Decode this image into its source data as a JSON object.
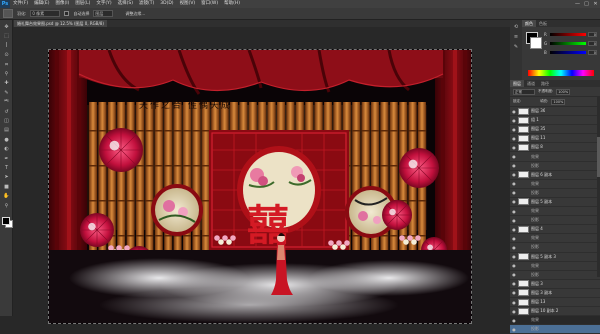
{
  "app": {
    "logo": "Ps",
    "menu": [
      "文件(F)",
      "编辑(E)",
      "图像(I)",
      "图层(L)",
      "文字(Y)",
      "选择(S)",
      "滤镜(T)",
      "3D(D)",
      "视图(V)",
      "窗口(W)",
      "帮助(H)"
    ],
    "window_controls": [
      "—",
      "□",
      "✕"
    ]
  },
  "options_bar": {
    "feather_label": "羽化:",
    "feather_value": "0 像素",
    "refine_label": "调整边缘...",
    "checkbox_label": "自动选择",
    "select_value": "图层"
  },
  "document": {
    "tab_title": "婚礼舞台效果图.psd @ 12.5% (图层 0, RGB/8)"
  },
  "toolbar": {
    "icons": [
      "move-icon",
      "marquee-icon",
      "lasso-icon",
      "quick-select-icon",
      "crop-icon",
      "eyedropper-icon",
      "healing-icon",
      "brush-icon",
      "stamp-icon",
      "history-brush-icon",
      "eraser-icon",
      "gradient-icon",
      "blur-icon",
      "dodge-icon",
      "pen-icon",
      "text-icon",
      "path-select-icon",
      "shape-icon",
      "hand-icon",
      "zoom-icon"
    ],
    "glyphs": [
      "✥",
      "⬚",
      "ꟾ",
      "⊙",
      "⌗",
      "⚲",
      "✚",
      "✎",
      "⎃",
      "↺",
      "◫",
      "▤",
      "●",
      "◐",
      "✒",
      "T",
      "➤",
      "■",
      "✋",
      "⚲"
    ]
  },
  "color_panel": {
    "tabs": [
      "颜色",
      "色板"
    ],
    "channels": [
      {
        "label": "R",
        "value": "0"
      },
      {
        "label": "G",
        "value": "0"
      },
      {
        "label": "B",
        "value": "0"
      }
    ]
  },
  "layers_panel": {
    "tabs": [
      "图层",
      "通道",
      "路径"
    ],
    "blend_mode": "正常",
    "opacity_label": "不透明度:",
    "opacity_value": "100%",
    "lock_label": "锁定:",
    "fill_label": "填充:",
    "fill_value": "100%",
    "layers": [
      {
        "name": "图层 36",
        "fx": false
      },
      {
        "name": "组 1",
        "fx": false
      },
      {
        "name": "图层 35",
        "fx": false
      },
      {
        "name": "图层 11",
        "fx": false
      },
      {
        "name": "图层 8",
        "fx": false
      },
      {
        "name": "效果",
        "fx": true
      },
      {
        "name": "投影",
        "fx": true
      },
      {
        "name": "图层 6 副本",
        "fx": false
      },
      {
        "name": "效果",
        "fx": true
      },
      {
        "name": "投影",
        "fx": true
      },
      {
        "name": "图层 5 副本",
        "fx": false
      },
      {
        "name": "效果",
        "fx": true
      },
      {
        "name": "投影",
        "fx": true
      },
      {
        "name": "图层 4",
        "fx": false
      },
      {
        "name": "效果",
        "fx": true
      },
      {
        "name": "投影",
        "fx": true
      },
      {
        "name": "图层 5 副本 3",
        "fx": false
      },
      {
        "name": "效果",
        "fx": true
      },
      {
        "name": "投影",
        "fx": true
      },
      {
        "name": "图层 3",
        "fx": false
      },
      {
        "name": "图层 3 副本",
        "fx": false
      },
      {
        "name": "图层 13",
        "fx": false
      },
      {
        "name": "图层 10 副本 2",
        "fx": false
      },
      {
        "name": "效果",
        "fx": true
      },
      {
        "name": "投影",
        "fx": true
      }
    ],
    "active_index": 24
  },
  "canvas": {
    "double_happiness": "囍",
    "calligraphy": "天作之合 佳偶天成"
  },
  "colors": {
    "curtain": "#7a0a10",
    "curtain_dark": "#3a0206",
    "bamboo": "#b8621e",
    "umbrella": "#d0144a",
    "lattice": "#b01018",
    "fog": "#e6e6ea"
  }
}
